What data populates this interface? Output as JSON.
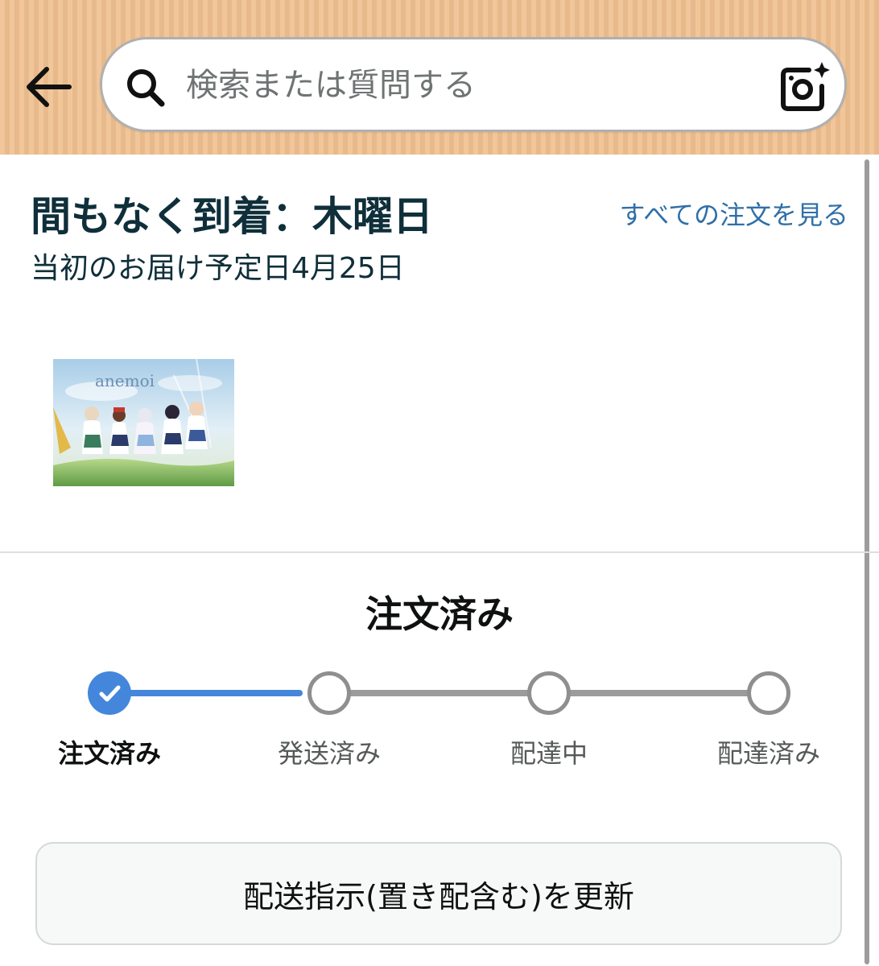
{
  "header": {
    "search": {
      "placeholder": "検索または質問する"
    },
    "background_color": "#efc08f"
  },
  "arrival": {
    "title": "間もなく到着：木曜日",
    "original_date": "当初のお届け予定日4月25日",
    "all_orders_link": "すべての注文を見る",
    "link_color": "#2f6fa7"
  },
  "product": {
    "thumbnail_title": "anemoi"
  },
  "tracker": {
    "heading": "注文済み",
    "steps": [
      {
        "label": "注文済み",
        "state": "done"
      },
      {
        "label": "発送済み",
        "state": "pending"
      },
      {
        "label": "配達中",
        "state": "pending"
      },
      {
        "label": "配達済み",
        "state": "pending"
      }
    ],
    "progress_color": "#4486db"
  },
  "actions": {
    "update_delivery_label": "配送指示(置き配含む)を更新"
  }
}
